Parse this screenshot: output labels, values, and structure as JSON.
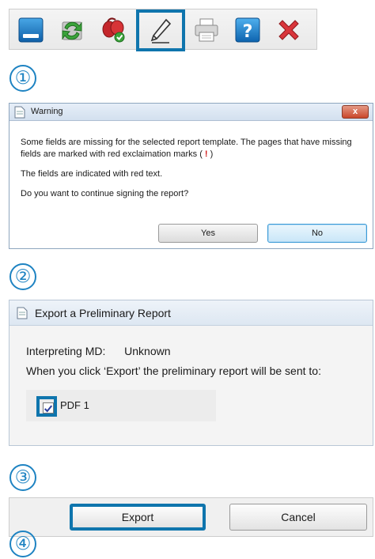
{
  "toolbar": {
    "buttons": [
      {
        "icon": "window-icon"
      },
      {
        "icon": "refresh-icon"
      },
      {
        "icon": "organ-check-icon"
      },
      {
        "icon": "sign-pen-icon",
        "selected": true
      },
      {
        "icon": "printer-icon"
      },
      {
        "icon": "help-icon"
      },
      {
        "icon": "close-x-icon"
      }
    ]
  },
  "steps": [
    "①",
    "②",
    "③",
    "④"
  ],
  "warning": {
    "title": "Warning",
    "close_label": "x",
    "line1": "Some fields are missing for the selected report template. The pages that have missing fields are marked with red exclaimation marks (",
    "mark": "!",
    "line1_end": ")",
    "line2": "The fields are indicated with red text.",
    "line3": "Do you want to continue signing the report?",
    "yes_label": "Yes",
    "no_label": "No"
  },
  "export_dialog": {
    "title": "Export a Preliminary Report",
    "interpreting_label": "Interpreting MD:",
    "interpreting_value": "Unknown",
    "instruction": "When you click ‘Export’ the preliminary report will be sent to:",
    "targets": [
      {
        "label": "PDF 1",
        "checked": true
      }
    ]
  },
  "actions": {
    "export_label": "Export",
    "cancel_label": "Cancel"
  },
  "colors": {
    "highlight": "#0f75ad",
    "step": "#1e83c2",
    "warning_mark": "#d21f1f"
  }
}
